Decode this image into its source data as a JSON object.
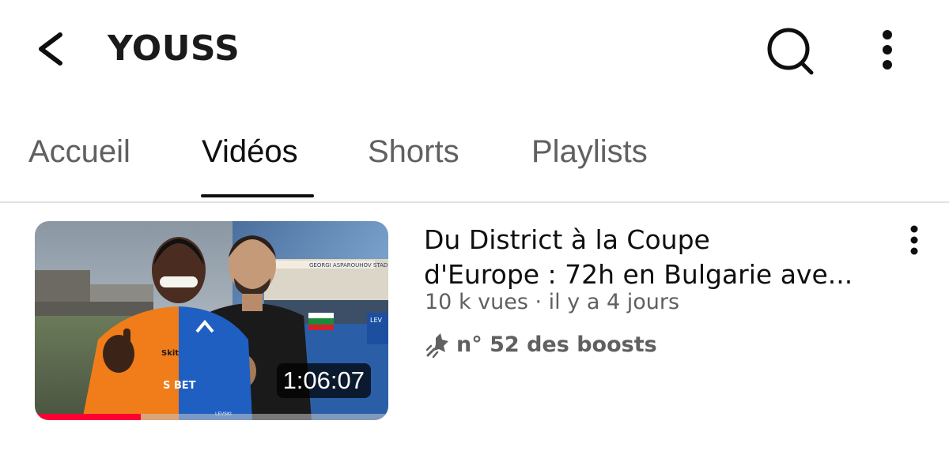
{
  "header": {
    "channel_name": "YOUSS",
    "back_icon": "back-arrow-icon",
    "search_icon": "search-icon",
    "more_icon": "more-vertical-icon"
  },
  "tabs": [
    {
      "label": "Accueil",
      "active": false
    },
    {
      "label": "Vidéos",
      "active": true
    },
    {
      "label": "Shorts",
      "active": false
    },
    {
      "label": "Playlists",
      "active": false
    }
  ],
  "video": {
    "title_line1": "Du District à la Coupe",
    "title_line2": "d'Europe : 72h en Bulgarie ave...",
    "meta": "10 k vues · il y a 4 jours",
    "boost_label": "n° 52 des boosts",
    "boost_icon": "boost-rocket-icon",
    "duration": "1:06:07",
    "watch_progress": 0.3,
    "thumbnail_texts": {
      "stadium_sign": "GEORGI ASPAROUHOV STADIUM",
      "sponsor_1": "Skit",
      "sponsor_2": "S BET",
      "side_label": "LEV",
      "bottom_label": "LEVSKI"
    },
    "more_icon": "more-vertical-icon"
  },
  "colors": {
    "accent_red": "#ff0033",
    "text_primary": "#0f0f0f",
    "text_secondary": "#606060"
  }
}
